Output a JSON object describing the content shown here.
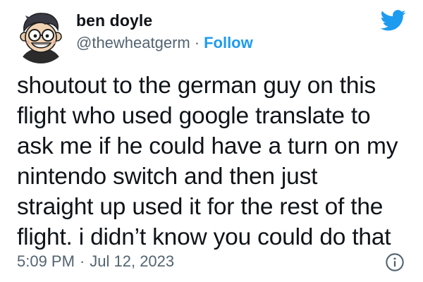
{
  "author": {
    "name": "ben doyle",
    "handle": "@thewheatgerm",
    "separator": "·",
    "follow_label": "Follow"
  },
  "tweet": {
    "lines": [
      "shoutout to the german guy on this",
      "flight who used google translate to",
      "ask me if he could have a turn on my",
      "nintendo switch and then just",
      "straight up used it for the rest of the",
      "flight. i didn’t know you could do that"
    ]
  },
  "meta": {
    "time": "5:09 PM",
    "separator": "·",
    "date": "Jul 12, 2023"
  },
  "icons": {
    "brand": "twitter-bird-icon",
    "info": "info-icon"
  },
  "colors": {
    "brand_blue": "#1d9bf0",
    "text_primary": "#0f1419",
    "text_secondary": "#536471"
  }
}
